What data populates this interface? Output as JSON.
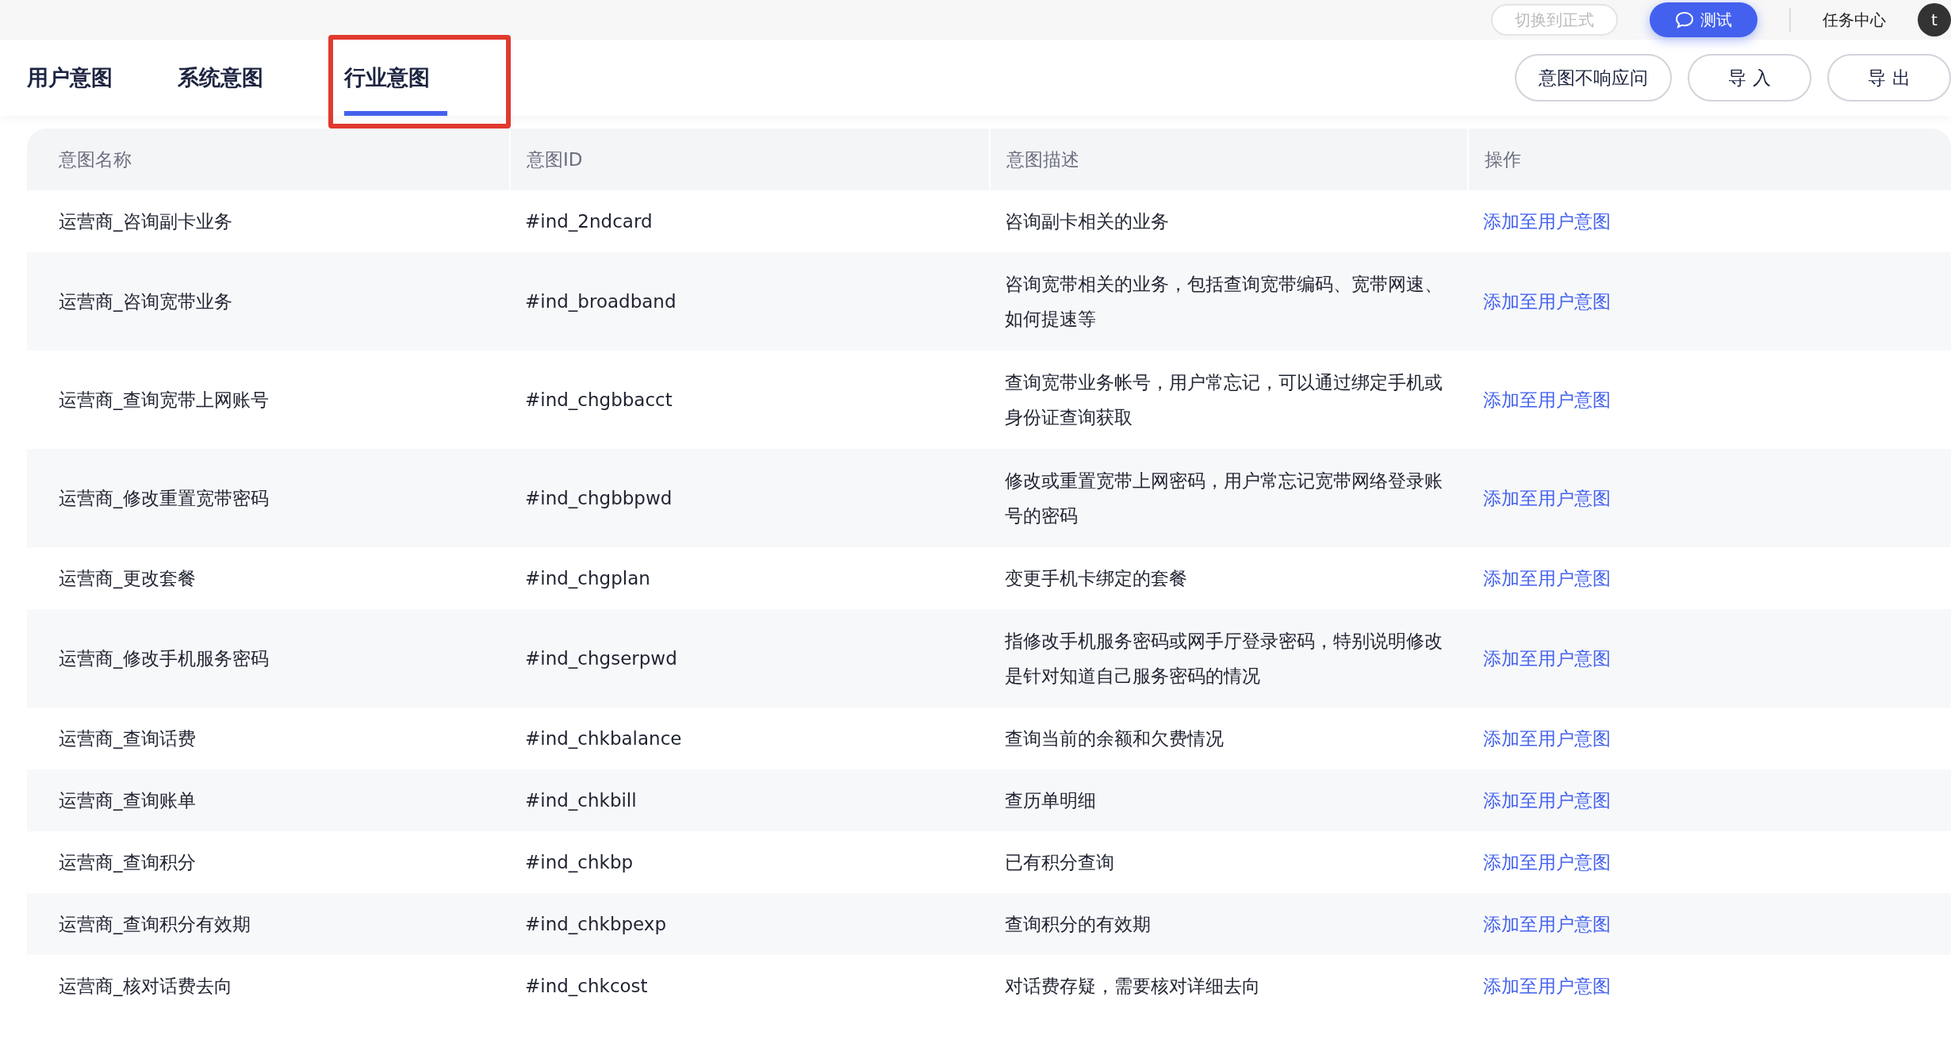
{
  "top_bar": {
    "switch_button": "切换到正式",
    "test_button": "测试",
    "task_center": "任务中心",
    "avatar_letter": "t"
  },
  "tabs": [
    {
      "label": "用户意图",
      "selected": false,
      "annotated": false
    },
    {
      "label": "系统意图",
      "selected": false,
      "annotated": false
    },
    {
      "label": "行业意图",
      "selected": true,
      "annotated": true
    }
  ],
  "actions": [
    "意图不响应问",
    "导 入",
    "导 出"
  ],
  "table": {
    "columns": [
      "意图名称",
      "意图ID",
      "意图描述",
      "操作"
    ],
    "rows": [
      {
        "name": "运营商_咨询副卡业务",
        "id": "#ind_2ndcard",
        "description": "咨询副卡相关的业务",
        "action": "添加至用户意图"
      },
      {
        "name": "运营商_咨询宽带业务",
        "id": "#ind_broadband",
        "description": "咨询宽带相关的业务，包括查询宽带编码、宽带网速、如何提速等",
        "action": "添加至用户意图"
      },
      {
        "name": "运营商_查询宽带上网账号",
        "id": "#ind_chgbbacct",
        "description": "查询宽带业务帐号，用户常忘记，可以通过绑定手机或身份证查询获取",
        "action": "添加至用户意图"
      },
      {
        "name": "运营商_修改重置宽带密码",
        "id": "#ind_chgbbpwd",
        "description": "修改或重置宽带上网密码，用户常忘记宽带网络登录账号的密码",
        "action": "添加至用户意图"
      },
      {
        "name": "运营商_更改套餐",
        "id": "#ind_chgplan",
        "description": "变更手机卡绑定的套餐",
        "action": "添加至用户意图"
      },
      {
        "name": "运营商_修改手机服务密码",
        "id": "#ind_chgserpwd",
        "description": "指修改手机服务密码或网手厅登录密码，特别说明修改是针对知道自己服务密码的情况",
        "action": "添加至用户意图"
      },
      {
        "name": "运营商_查询话费",
        "id": "#ind_chkbalance",
        "description": "查询当前的余额和欠费情况",
        "action": "添加至用户意图"
      },
      {
        "name": "运营商_查询账单",
        "id": "#ind_chkbill",
        "description": "查历单明细",
        "action": "添加至用户意图"
      },
      {
        "name": "运营商_查询积分",
        "id": "#ind_chkbp",
        "description": "已有积分查询",
        "action": "添加至用户意图"
      },
      {
        "name": "运营商_查询积分有效期",
        "id": "#ind_chkbpexp",
        "description": "查询积分的有效期",
        "action": "添加至用户意图"
      },
      {
        "name": "运营商_核对话费去向",
        "id": "#ind_chkcost",
        "description": "对话费存疑，需要核对详细去向",
        "action": "添加至用户意图"
      }
    ]
  }
}
